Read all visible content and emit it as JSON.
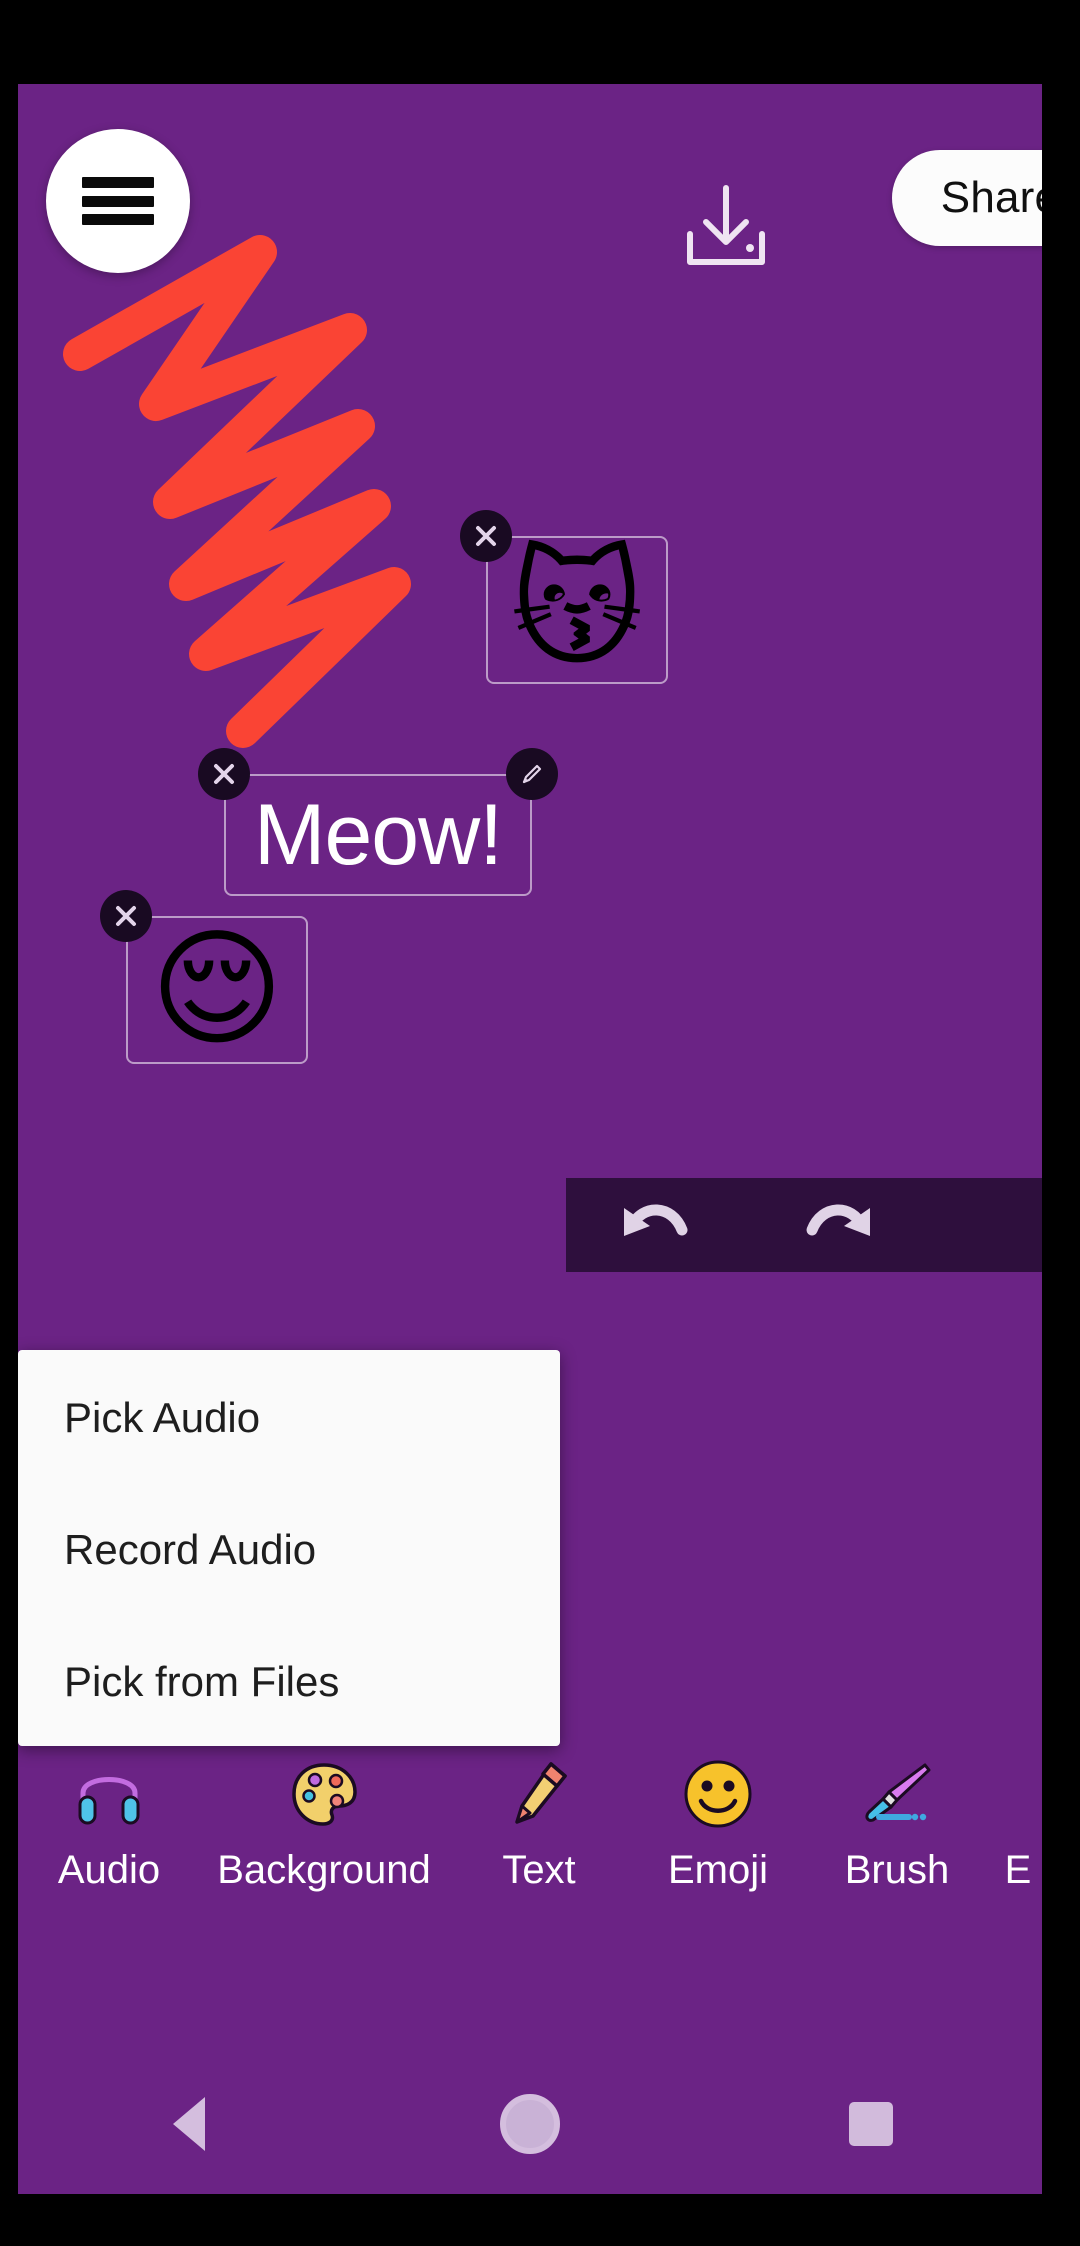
{
  "app": {
    "background_color": "#6B2385",
    "accent_red": "#FA4434",
    "panel_dark": "#2E0F3D"
  },
  "topbar": {
    "menu_button": {
      "icon": "hamburger-menu-icon",
      "label": "Menu"
    },
    "save_button": {
      "icon": "save-download-icon",
      "label": "Save"
    },
    "share_button": {
      "label": "Share"
    }
  },
  "canvas": {
    "drawing": {
      "name": "red-scribble",
      "color": "#FA4434"
    },
    "objects": [
      {
        "id": "cat-emoji",
        "type": "emoji",
        "glyph": "😽",
        "name": "kissing-cat-face",
        "handles": [
          "delete"
        ]
      },
      {
        "id": "text-element",
        "type": "text",
        "value": "Meow!",
        "handles": [
          "delete",
          "edit"
        ]
      },
      {
        "id": "relieved-emoji",
        "type": "emoji",
        "glyph": "😌",
        "name": "relieved-face",
        "handles": [
          "delete"
        ]
      }
    ]
  },
  "history": {
    "undo_label": "Undo",
    "redo_label": "Redo"
  },
  "popup": {
    "items": [
      {
        "label": "Pick Audio"
      },
      {
        "label": "Record Audio"
      },
      {
        "label": "Pick from Files"
      }
    ]
  },
  "toolbar": {
    "items": [
      {
        "label": "Audio",
        "icon": "headphones-icon",
        "glyph": "🎧"
      },
      {
        "label": "Background",
        "icon": "palette-icon",
        "glyph": "🎨"
      },
      {
        "label": "Text",
        "icon": "pencil-icon",
        "glyph": "✏️"
      },
      {
        "label": "Emoji",
        "icon": "smiley-icon",
        "glyph": "🙂"
      },
      {
        "label": "Brush",
        "icon": "paintbrush-icon",
        "glyph": "🖌️"
      },
      {
        "label": "E",
        "icon": "cut-off-icon",
        "glyph": ""
      }
    ]
  },
  "navbar": {
    "back_label": "Back",
    "home_label": "Home",
    "recents_label": "Recents"
  }
}
